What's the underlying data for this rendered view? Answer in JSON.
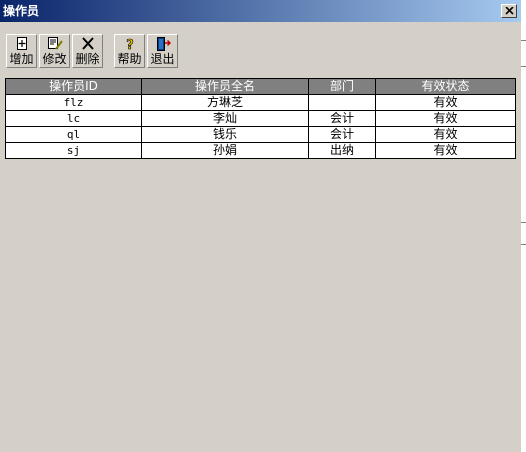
{
  "window": {
    "title": "操作员"
  },
  "toolbar": [
    {
      "name": "add-button",
      "icon": "add-doc-icon",
      "label": "增加"
    },
    {
      "name": "edit-button",
      "icon": "edit-doc-icon",
      "label": "修改"
    },
    {
      "name": "delete-button",
      "icon": "delete-x-icon",
      "label": "删除"
    },
    {
      "name": "help-button",
      "icon": "help-icon",
      "label": "帮助"
    },
    {
      "name": "exit-button",
      "icon": "exit-door-icon",
      "label": "退出"
    }
  ],
  "table": {
    "headers": [
      "操作员ID",
      "操作员全名",
      "部门",
      "有效状态"
    ],
    "rows": [
      [
        "flz",
        "方琳芝",
        "",
        "有效"
      ],
      [
        "lc",
        "李灿",
        "会计",
        "有效"
      ],
      [
        "ql",
        "钱乐",
        "会计",
        "有效"
      ],
      [
        "sj",
        "孙娟",
        "出纳",
        "有效"
      ]
    ]
  },
  "colors": {
    "titlebar_start": "#0a246a",
    "titlebar_end": "#a6caf0",
    "header_bg": "#808080",
    "face": "#d4d0c8"
  }
}
